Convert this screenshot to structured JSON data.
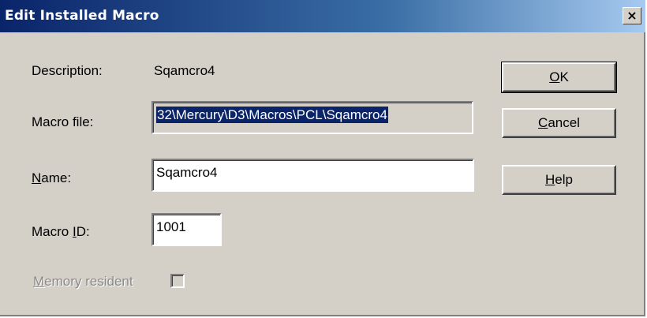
{
  "window": {
    "title": "Edit Installed Macro",
    "close_glyph": "×"
  },
  "form": {
    "description_label": "Description:",
    "description_value": "Sqamcro4",
    "macro_file_label": "Macro file:",
    "macro_file_value": "32\\Mercury\\D3\\Macros\\PCL\\Sqamcro4",
    "name_label_pre": "",
    "name_label_ul": "N",
    "name_label_post": "ame:",
    "name_value": "Sqamcro4",
    "macro_id_label_pre": "Macro ",
    "macro_id_label_ul": "I",
    "macro_id_label_post": "D:",
    "macro_id_value": "1001",
    "memory_resident_label_pre": "",
    "memory_resident_label_ul": "M",
    "memory_resident_label_post": "emory resident",
    "memory_resident_checked": false,
    "memory_resident_enabled": false
  },
  "buttons": {
    "ok_ul": "O",
    "ok_post": "K",
    "cancel_ul": "C",
    "cancel_post": "ancel",
    "help_ul": "H",
    "help_post": "elp"
  },
  "colors": {
    "face": "#d4d0c8",
    "title_start": "#0a246a",
    "title_end": "#a6caf0",
    "selection": "#0a246a"
  }
}
